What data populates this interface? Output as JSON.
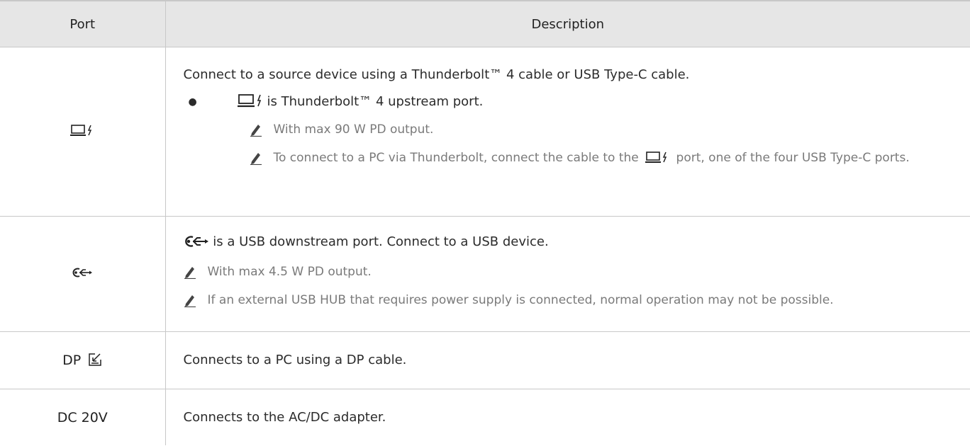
{
  "header": {
    "port": "Port",
    "description": "Description"
  },
  "rows": [
    {
      "port_icon": "laptop-thunderbolt-icon",
      "main": "Connect to a source device using a Thunderbolt™ 4 cable or USB Type-C cable.",
      "bullet": "is Thunderbolt™ 4 upstream port.",
      "notes": [
        "With max 90 W PD output.",
        "To connect to a PC via Thunderbolt, connect the cable to the",
        "port, one of the four USB Type-C ports."
      ]
    },
    {
      "port_icon": "usb-icon",
      "main": "is a USB downstream port. Connect to a USB device.",
      "notes": [
        "With max 4.5 W PD output.",
        "If an external USB HUB that requires power supply is connected, normal operation may not be possible."
      ]
    },
    {
      "port_label": "DP",
      "port_icon": "dp-input-icon",
      "main": "Connects to a PC using a DP cable."
    },
    {
      "port_label": "DC 20V",
      "main": "Connects to the AC/DC adapter."
    }
  ]
}
